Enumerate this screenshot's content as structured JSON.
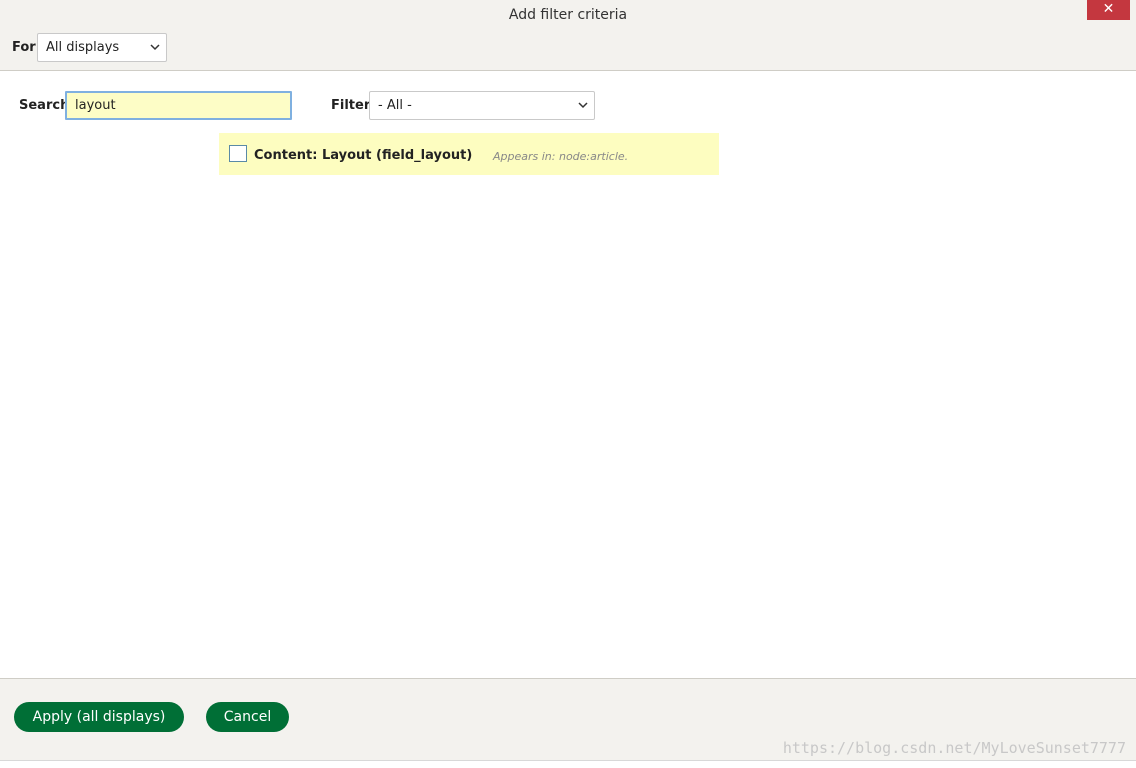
{
  "dialog": {
    "title": "Add filter criteria",
    "close_glyph": "✕"
  },
  "header": {
    "for_label": "For",
    "for_select_value": "All displays"
  },
  "search": {
    "label": "Search",
    "value": "layout"
  },
  "filter": {
    "label": "Filter",
    "select_value": "- All -"
  },
  "results": [
    {
      "title": "Content: Layout (field_layout)",
      "appears_in": "Appears in: node:article."
    }
  ],
  "footer": {
    "apply_label": "Apply (all displays)",
    "cancel_label": "Cancel"
  },
  "watermark": "https://blog.csdn.net/MyLoveSunset7777",
  "colors": {
    "primary_button": "#006f36",
    "close_button": "#c4373f",
    "highlight": "#fdfdc0"
  },
  "icons": {
    "close": "close-icon",
    "dropdown": "chevron-down-icon"
  }
}
